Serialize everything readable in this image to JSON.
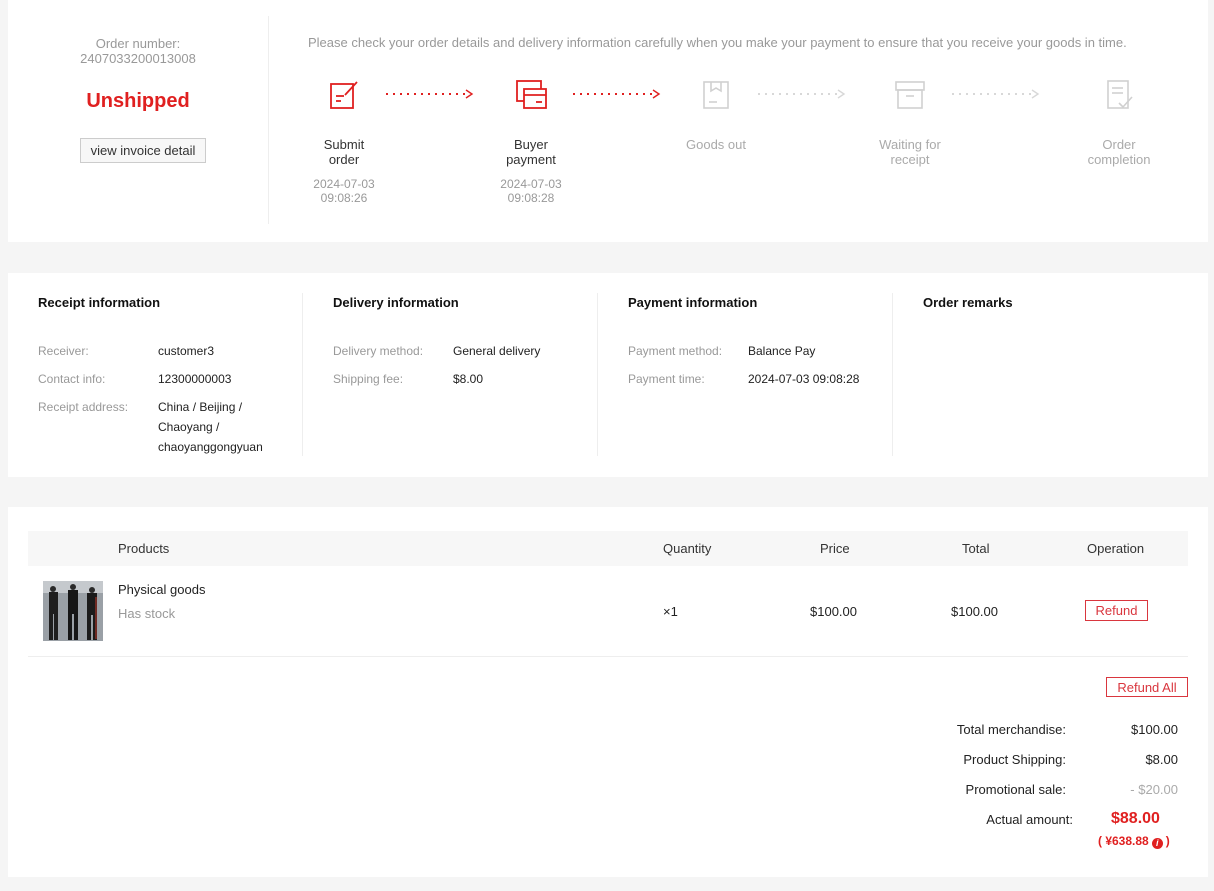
{
  "order": {
    "number_label": "Order number:",
    "number": "2407033200013008",
    "status": "Unshipped",
    "invoice_button": "view invoice detail",
    "notice": "Please check your order details and delivery information carefully when you make your payment to ensure that you receive your goods in time."
  },
  "steps": [
    {
      "label": "Submit order",
      "date": "2024-07-03",
      "time": "09:08:26",
      "active": true,
      "icon": "submit-order-icon"
    },
    {
      "label": "Buyer payment",
      "date": "2024-07-03",
      "time": "09:08:28",
      "active": true,
      "icon": "payment-card-icon"
    },
    {
      "label": "Goods out",
      "date": "",
      "time": "",
      "active": false,
      "icon": "goods-out-icon"
    },
    {
      "label": "Waiting for receipt",
      "date": "",
      "time": "",
      "active": false,
      "icon": "box-icon"
    },
    {
      "label": "Order completion",
      "date": "",
      "time": "",
      "active": false,
      "icon": "document-check-icon"
    }
  ],
  "receipt": {
    "title": "Receipt information",
    "receiver_label": "Receiver:",
    "receiver": "customer3",
    "contact_label": "Contact info:",
    "contact": "12300000003",
    "address_label": "Receipt address:",
    "address": "China / Beijing / Chaoyang / chaoyanggongyuan"
  },
  "delivery": {
    "title": "Delivery information",
    "method_label": "Delivery method:",
    "method": "General delivery",
    "fee_label": "Shipping fee:",
    "fee": "$8.00"
  },
  "payment": {
    "title": "Payment information",
    "method_label": "Payment method:",
    "method": "Balance Pay",
    "time_label": "Payment time:",
    "time": "2024-07-03 09:08:28"
  },
  "remarks": {
    "title": "Order remarks"
  },
  "table": {
    "headers": {
      "products": "Products",
      "quantity": "Quantity",
      "price": "Price",
      "total": "Total",
      "operation": "Operation"
    },
    "rows": [
      {
        "name": "Physical goods",
        "stock": "Has stock",
        "quantity": "×1",
        "price": "$100.00",
        "total": "$100.00",
        "action": "Refund"
      }
    ],
    "refund_all": "Refund All"
  },
  "summary": {
    "merch_label": "Total merchandise:",
    "merch": "$100.00",
    "shipping_label": "Product Shipping:",
    "shipping": "$8.00",
    "promo_label": "Promotional sale:",
    "promo": "- $20.00",
    "actual_label": "Actual amount:",
    "actual": "$88.00",
    "cny_open": "( ¥638.88",
    "cny_close": ")"
  },
  "colors": {
    "accent": "#e02020",
    "inactive": "#cccccc"
  }
}
